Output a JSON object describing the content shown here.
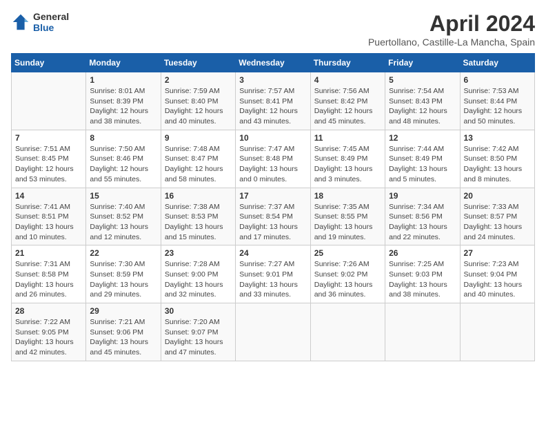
{
  "header": {
    "logo_line1": "General",
    "logo_line2": "Blue",
    "title": "April 2024",
    "subtitle": "Puertollano, Castille-La Mancha, Spain"
  },
  "weekdays": [
    "Sunday",
    "Monday",
    "Tuesday",
    "Wednesday",
    "Thursday",
    "Friday",
    "Saturday"
  ],
  "weeks": [
    [
      {
        "day": "",
        "sunrise": "",
        "sunset": "",
        "daylight": ""
      },
      {
        "day": "1",
        "sunrise": "Sunrise: 8:01 AM",
        "sunset": "Sunset: 8:39 PM",
        "daylight": "Daylight: 12 hours and 38 minutes."
      },
      {
        "day": "2",
        "sunrise": "Sunrise: 7:59 AM",
        "sunset": "Sunset: 8:40 PM",
        "daylight": "Daylight: 12 hours and 40 minutes."
      },
      {
        "day": "3",
        "sunrise": "Sunrise: 7:57 AM",
        "sunset": "Sunset: 8:41 PM",
        "daylight": "Daylight: 12 hours and 43 minutes."
      },
      {
        "day": "4",
        "sunrise": "Sunrise: 7:56 AM",
        "sunset": "Sunset: 8:42 PM",
        "daylight": "Daylight: 12 hours and 45 minutes."
      },
      {
        "day": "5",
        "sunrise": "Sunrise: 7:54 AM",
        "sunset": "Sunset: 8:43 PM",
        "daylight": "Daylight: 12 hours and 48 minutes."
      },
      {
        "day": "6",
        "sunrise": "Sunrise: 7:53 AM",
        "sunset": "Sunset: 8:44 PM",
        "daylight": "Daylight: 12 hours and 50 minutes."
      }
    ],
    [
      {
        "day": "7",
        "sunrise": "Sunrise: 7:51 AM",
        "sunset": "Sunset: 8:45 PM",
        "daylight": "Daylight: 12 hours and 53 minutes."
      },
      {
        "day": "8",
        "sunrise": "Sunrise: 7:50 AM",
        "sunset": "Sunset: 8:46 PM",
        "daylight": "Daylight: 12 hours and 55 minutes."
      },
      {
        "day": "9",
        "sunrise": "Sunrise: 7:48 AM",
        "sunset": "Sunset: 8:47 PM",
        "daylight": "Daylight: 12 hours and 58 minutes."
      },
      {
        "day": "10",
        "sunrise": "Sunrise: 7:47 AM",
        "sunset": "Sunset: 8:48 PM",
        "daylight": "Daylight: 13 hours and 0 minutes."
      },
      {
        "day": "11",
        "sunrise": "Sunrise: 7:45 AM",
        "sunset": "Sunset: 8:49 PM",
        "daylight": "Daylight: 13 hours and 3 minutes."
      },
      {
        "day": "12",
        "sunrise": "Sunrise: 7:44 AM",
        "sunset": "Sunset: 8:49 PM",
        "daylight": "Daylight: 13 hours and 5 minutes."
      },
      {
        "day": "13",
        "sunrise": "Sunrise: 7:42 AM",
        "sunset": "Sunset: 8:50 PM",
        "daylight": "Daylight: 13 hours and 8 minutes."
      }
    ],
    [
      {
        "day": "14",
        "sunrise": "Sunrise: 7:41 AM",
        "sunset": "Sunset: 8:51 PM",
        "daylight": "Daylight: 13 hours and 10 minutes."
      },
      {
        "day": "15",
        "sunrise": "Sunrise: 7:40 AM",
        "sunset": "Sunset: 8:52 PM",
        "daylight": "Daylight: 13 hours and 12 minutes."
      },
      {
        "day": "16",
        "sunrise": "Sunrise: 7:38 AM",
        "sunset": "Sunset: 8:53 PM",
        "daylight": "Daylight: 13 hours and 15 minutes."
      },
      {
        "day": "17",
        "sunrise": "Sunrise: 7:37 AM",
        "sunset": "Sunset: 8:54 PM",
        "daylight": "Daylight: 13 hours and 17 minutes."
      },
      {
        "day": "18",
        "sunrise": "Sunrise: 7:35 AM",
        "sunset": "Sunset: 8:55 PM",
        "daylight": "Daylight: 13 hours and 19 minutes."
      },
      {
        "day": "19",
        "sunrise": "Sunrise: 7:34 AM",
        "sunset": "Sunset: 8:56 PM",
        "daylight": "Daylight: 13 hours and 22 minutes."
      },
      {
        "day": "20",
        "sunrise": "Sunrise: 7:33 AM",
        "sunset": "Sunset: 8:57 PM",
        "daylight": "Daylight: 13 hours and 24 minutes."
      }
    ],
    [
      {
        "day": "21",
        "sunrise": "Sunrise: 7:31 AM",
        "sunset": "Sunset: 8:58 PM",
        "daylight": "Daylight: 13 hours and 26 minutes."
      },
      {
        "day": "22",
        "sunrise": "Sunrise: 7:30 AM",
        "sunset": "Sunset: 8:59 PM",
        "daylight": "Daylight: 13 hours and 29 minutes."
      },
      {
        "day": "23",
        "sunrise": "Sunrise: 7:28 AM",
        "sunset": "Sunset: 9:00 PM",
        "daylight": "Daylight: 13 hours and 32 minutes."
      },
      {
        "day": "24",
        "sunrise": "Sunrise: 7:27 AM",
        "sunset": "Sunset: 9:01 PM",
        "daylight": "Daylight: 13 hours and 33 minutes."
      },
      {
        "day": "25",
        "sunrise": "Sunrise: 7:26 AM",
        "sunset": "Sunset: 9:02 PM",
        "daylight": "Daylight: 13 hours and 36 minutes."
      },
      {
        "day": "26",
        "sunrise": "Sunrise: 7:25 AM",
        "sunset": "Sunset: 9:03 PM",
        "daylight": "Daylight: 13 hours and 38 minutes."
      },
      {
        "day": "27",
        "sunrise": "Sunrise: 7:23 AM",
        "sunset": "Sunset: 9:04 PM",
        "daylight": "Daylight: 13 hours and 40 minutes."
      }
    ],
    [
      {
        "day": "28",
        "sunrise": "Sunrise: 7:22 AM",
        "sunset": "Sunset: 9:05 PM",
        "daylight": "Daylight: 13 hours and 42 minutes."
      },
      {
        "day": "29",
        "sunrise": "Sunrise: 7:21 AM",
        "sunset": "Sunset: 9:06 PM",
        "daylight": "Daylight: 13 hours and 45 minutes."
      },
      {
        "day": "30",
        "sunrise": "Sunrise: 7:20 AM",
        "sunset": "Sunset: 9:07 PM",
        "daylight": "Daylight: 13 hours and 47 minutes."
      },
      {
        "day": "",
        "sunrise": "",
        "sunset": "",
        "daylight": ""
      },
      {
        "day": "",
        "sunrise": "",
        "sunset": "",
        "daylight": ""
      },
      {
        "day": "",
        "sunrise": "",
        "sunset": "",
        "daylight": ""
      },
      {
        "day": "",
        "sunrise": "",
        "sunset": "",
        "daylight": ""
      }
    ]
  ]
}
